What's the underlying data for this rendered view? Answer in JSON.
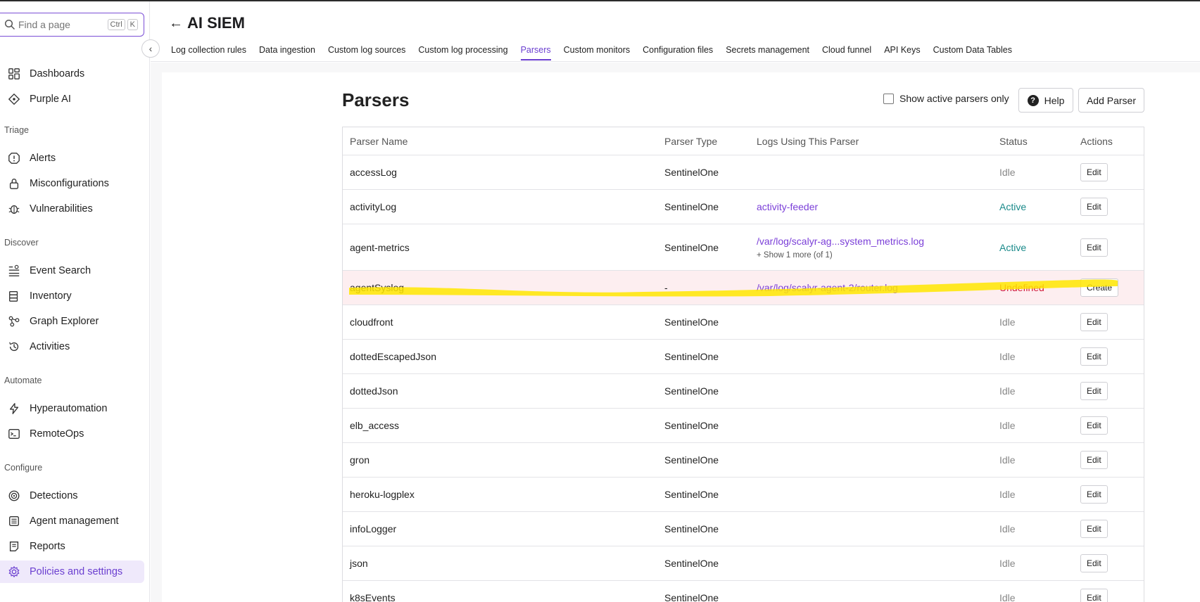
{
  "search": {
    "placeholder": "Find a page",
    "kbd_ctrl": "Ctrl",
    "kbd_k": "K"
  },
  "sidebar": {
    "top_items": [
      {
        "label": "Dashboards",
        "icon": "dashboard-icon"
      },
      {
        "label": "Purple AI",
        "icon": "purple-ai-icon"
      }
    ],
    "sections": [
      {
        "title": "Triage",
        "items": [
          {
            "label": "Alerts",
            "icon": "alert-icon"
          },
          {
            "label": "Misconfigurations",
            "icon": "lock-icon"
          },
          {
            "label": "Vulnerabilities",
            "icon": "bug-icon"
          }
        ]
      },
      {
        "title": "Discover",
        "items": [
          {
            "label": "Event Search",
            "icon": "event-search-icon"
          },
          {
            "label": "Inventory",
            "icon": "inventory-icon"
          },
          {
            "label": "Graph Explorer",
            "icon": "graph-icon"
          },
          {
            "label": "Activities",
            "icon": "history-icon"
          }
        ]
      },
      {
        "title": "Automate",
        "items": [
          {
            "label": "Hyperautomation",
            "icon": "lightning-icon"
          },
          {
            "label": "RemoteOps",
            "icon": "terminal-icon"
          }
        ]
      },
      {
        "title": "Configure",
        "items": [
          {
            "label": "Detections",
            "icon": "detections-icon"
          },
          {
            "label": "Agent management",
            "icon": "agent-icon"
          },
          {
            "label": "Reports",
            "icon": "report-icon"
          },
          {
            "label": "Policies and settings",
            "icon": "gear-icon",
            "active": true
          }
        ]
      }
    ]
  },
  "header": {
    "title": "AI SIEM",
    "tabs": [
      "Log collection rules",
      "Data ingestion",
      "Custom log sources",
      "Custom log processing",
      "Parsers",
      "Custom monitors",
      "Configuration files",
      "Secrets management",
      "Cloud funnel",
      "API Keys",
      "Custom Data Tables"
    ],
    "active_tab": "Parsers"
  },
  "page": {
    "title": "Parsers",
    "show_active_label": "Show active parsers only",
    "help_label": "Help",
    "add_label": "Add Parser"
  },
  "table": {
    "columns": [
      "Parser Name",
      "Parser Type",
      "Logs Using This Parser",
      "Status",
      "Actions"
    ],
    "rows": [
      {
        "name": "accessLog",
        "type": "SentinelOne",
        "logs": "",
        "status": "Idle",
        "action": "Edit"
      },
      {
        "name": "activityLog",
        "type": "SentinelOne",
        "logs": "activity-feeder",
        "status": "Active",
        "action": "Edit"
      },
      {
        "name": "agent-metrics",
        "type": "SentinelOne",
        "logs": "/var/log/scalyr-ag...system_metrics.log",
        "more": "+ Show 1 more (of 1)",
        "status": "Active",
        "action": "Edit"
      },
      {
        "name": "agentSyslog",
        "type": "-",
        "logs": "/var/log/scalyr-agent-2/router.log",
        "status": "Undefined",
        "action": "Create"
      },
      {
        "name": "cloudfront",
        "type": "SentinelOne",
        "logs": "",
        "status": "Idle",
        "action": "Edit"
      },
      {
        "name": "dottedEscapedJson",
        "type": "SentinelOne",
        "logs": "",
        "status": "Idle",
        "action": "Edit"
      },
      {
        "name": "dottedJson",
        "type": "SentinelOne",
        "logs": "",
        "status": "Idle",
        "action": "Edit"
      },
      {
        "name": "elb_access",
        "type": "SentinelOne",
        "logs": "",
        "status": "Idle",
        "action": "Edit"
      },
      {
        "name": "gron",
        "type": "SentinelOne",
        "logs": "",
        "status": "Idle",
        "action": "Edit"
      },
      {
        "name": "heroku-logplex",
        "type": "SentinelOne",
        "logs": "",
        "status": "Idle",
        "action": "Edit"
      },
      {
        "name": "infoLogger",
        "type": "SentinelOne",
        "logs": "",
        "status": "Idle",
        "action": "Edit"
      },
      {
        "name": "json",
        "type": "SentinelOne",
        "logs": "",
        "status": "Idle",
        "action": "Edit"
      },
      {
        "name": "k8sEvents",
        "type": "SentinelOne",
        "logs": "",
        "status": "Idle",
        "action": "Edit"
      }
    ]
  },
  "colors": {
    "accent": "#6b3fd0",
    "active_status": "#1a8a8a",
    "undefined_status": "#d11a3a",
    "highlight": "#ffe600"
  }
}
